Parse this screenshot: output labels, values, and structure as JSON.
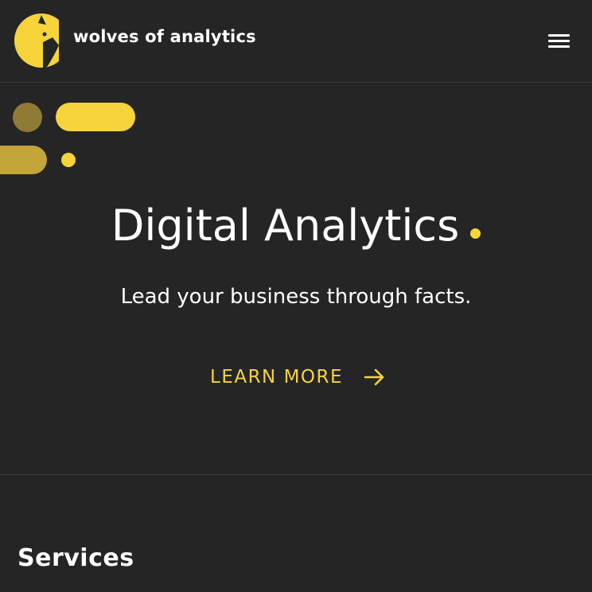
{
  "header": {
    "brand_name": "wolves of analytics",
    "logo_icon": "wolf-logo-icon",
    "menu_icon": "hamburger-menu-icon"
  },
  "hero": {
    "title": "Digital Analytics",
    "subtitle": "Lead your business through facts.",
    "cta_label": "LEARN MORE",
    "cta_icon": "arrow-right-icon"
  },
  "services": {
    "title": "Services"
  },
  "colors": {
    "background": "#252525",
    "accent": "#f6d43a",
    "accent_muted": "#8f7b35",
    "text": "#ffffff",
    "divider": "#3a3a3a"
  }
}
